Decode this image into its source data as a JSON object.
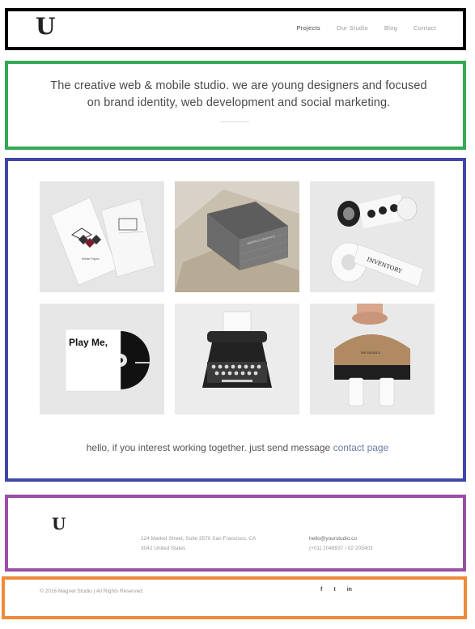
{
  "header": {
    "logo": "U",
    "nav": [
      "Projects",
      "Our Studio",
      "Blog",
      "Contact"
    ],
    "active_index": 0
  },
  "intro": {
    "text_line1": "The creative web & mobile studio. we are young designers and focused",
    "text_line2": "on brand identity, web development and social marketing."
  },
  "portfolio": {
    "items": [
      {
        "name": "business-cards",
        "label": "White Paper"
      },
      {
        "name": "book-stack",
        "label": "BUFFALO GRAPHICS"
      },
      {
        "name": "tape-rolls",
        "label": "INVENTORY"
      },
      {
        "name": "cd-cover",
        "label": "Play Me,"
      },
      {
        "name": "typewriter",
        "label": ""
      },
      {
        "name": "cup-carrier",
        "label": "THE BEAGLE"
      }
    ]
  },
  "cta": {
    "text": "hello, if you interest working together. just send message",
    "link": "contact page"
  },
  "footer": {
    "logo": "U",
    "address_line1": "124 Market Street, Suite 3570 San Francisco, CA",
    "address_line2": "3042 United States",
    "email": "hello@yourstudio.co",
    "phone": "(+01) 2048937 / 02 203403"
  },
  "bottom": {
    "copyright": "© 2016 Magnet Studio | All Rights Reserved.",
    "social": [
      "f",
      "t",
      "in"
    ]
  },
  "colors": {
    "header_box": "#000000",
    "intro_box": "#34a853",
    "work_box": "#3f46a8",
    "footer_box": "#9b4fa6",
    "bottom_box": "#ef8a3a",
    "link": "#6a7fa5"
  }
}
